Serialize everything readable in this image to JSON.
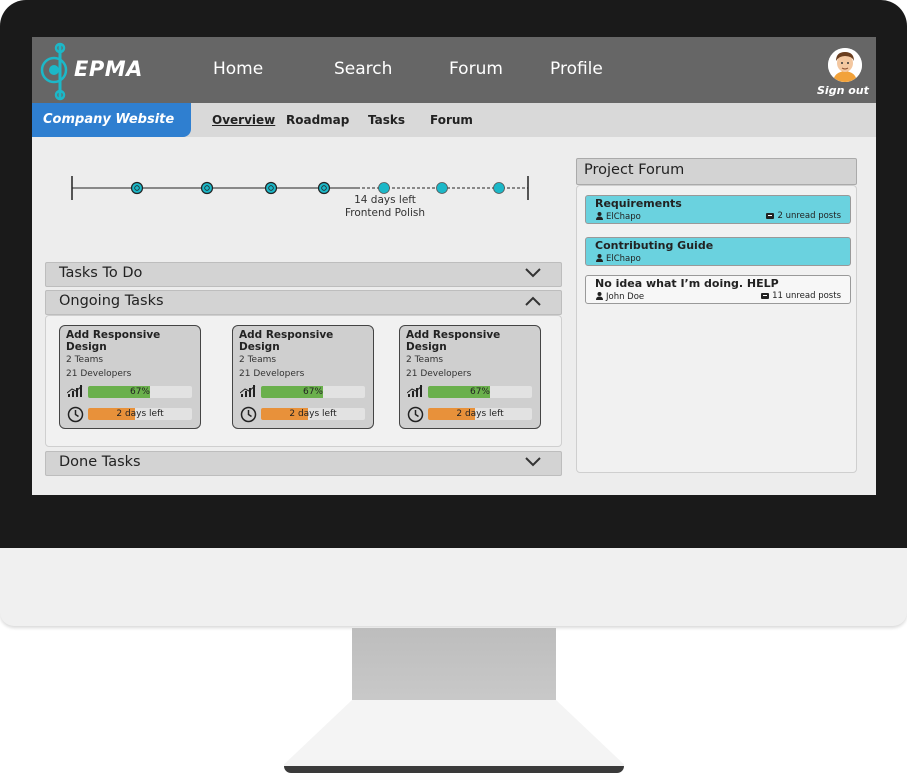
{
  "app": {
    "logo_text": "EPMA"
  },
  "topnav": {
    "links": [
      "Home",
      "Search",
      "Forum",
      "Profile"
    ],
    "signout_label": "Sign out"
  },
  "subnav": {
    "project_name": "Company Website",
    "tabs": [
      "Overview",
      "Roadmap",
      "Tasks",
      "Forum"
    ],
    "active_tab": "Overview"
  },
  "timeline": {
    "days_left": "14 days left",
    "milestone": "Frontend Polish"
  },
  "sections": {
    "todo": "Tasks To Do",
    "ongoing": "Ongoing Tasks",
    "done": "Done Tasks"
  },
  "tasks": [
    {
      "title": "Add Responsive Design",
      "teams": "2 Teams",
      "developers": "21 Developers",
      "progress": 0.6,
      "progress_label": "67%",
      "time_fraction": 0.45,
      "time_label": "2 days left"
    },
    {
      "title": "Add Responsive Design",
      "teams": "2 Teams",
      "developers": "21 Developers",
      "progress": 0.6,
      "progress_label": "67%",
      "time_fraction": 0.45,
      "time_label": "2 days left"
    },
    {
      "title": "Add Responsive Design",
      "teams": "2 Teams",
      "developers": "21 Developers",
      "progress": 0.6,
      "progress_label": "67%",
      "time_fraction": 0.45,
      "time_label": "2 days left"
    }
  ],
  "forum": {
    "title": "Project Forum",
    "posts": [
      {
        "title": "Requirements",
        "author": "ElChapo",
        "unread": "2 unread posts"
      },
      {
        "title": "Contributing Guide",
        "author": "ElChapo",
        "unread": ""
      },
      {
        "title": "No idea what I’m doing. HELP",
        "author": "John Doe",
        "unread": "11 unread posts"
      }
    ]
  },
  "colors": {
    "nav_bg": "#666666",
    "project_tab": "#2f7fd0",
    "accent_teal": "#1cb8c8",
    "progress_green": "#6ab04c",
    "time_orange": "#e8913a",
    "forum_highlight": "#6ad2df"
  },
  "icons": [
    "logo-icon",
    "chevron-down-icon",
    "chevron-up-icon",
    "signal-bars-icon",
    "clock-icon",
    "user-icon",
    "message-icon"
  ]
}
